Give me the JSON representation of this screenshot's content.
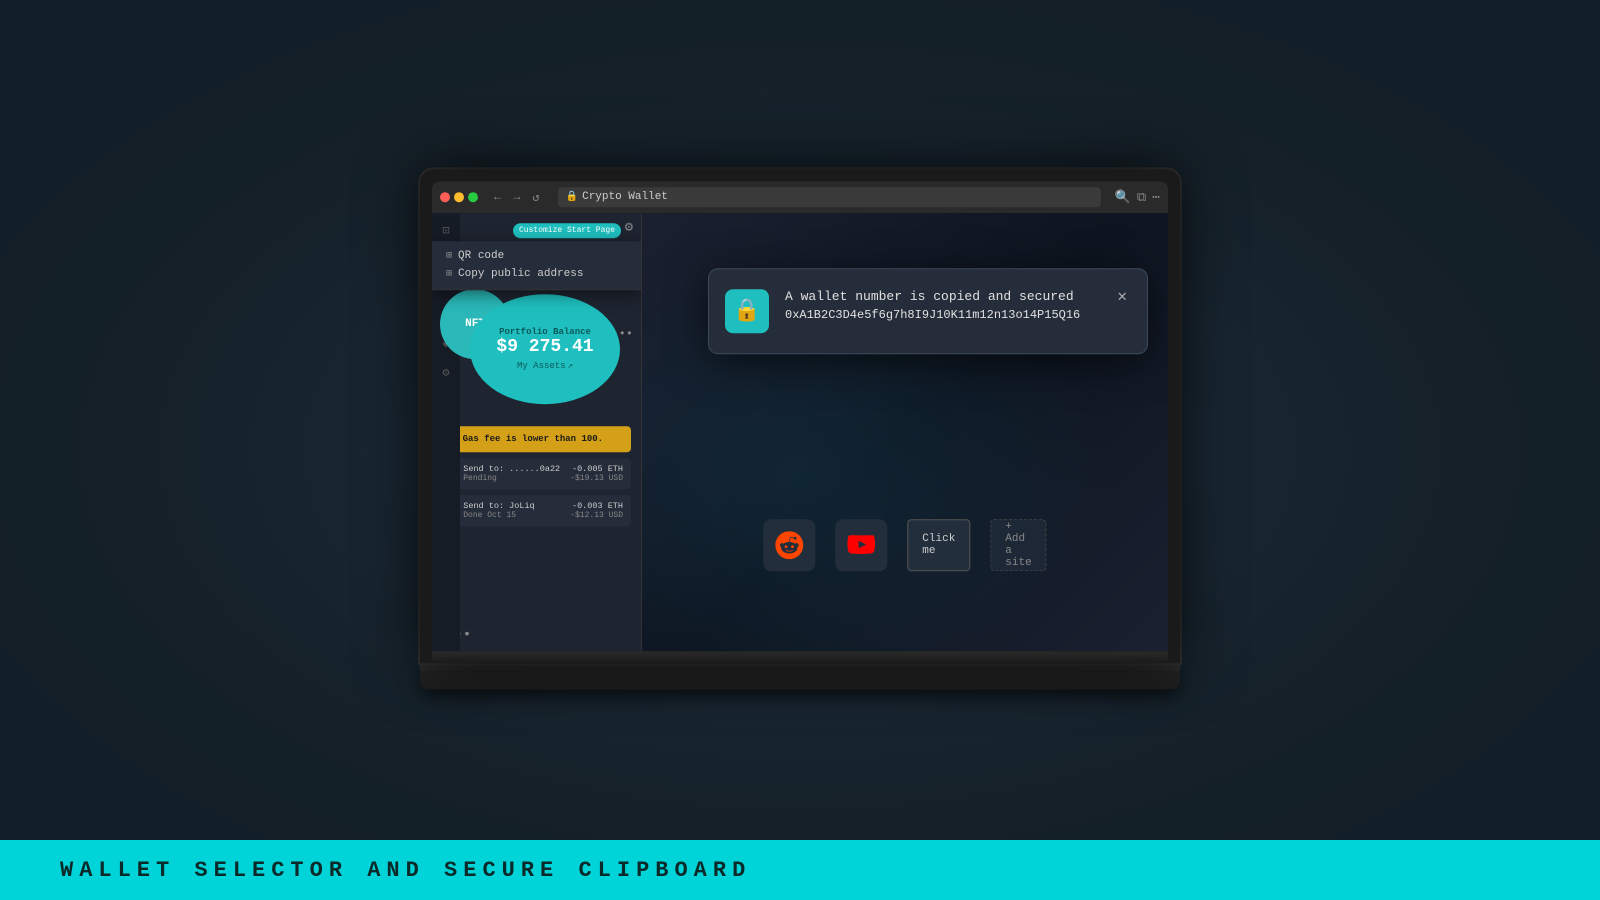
{
  "background": {
    "color": "#1a2a35"
  },
  "bottom_banner": {
    "text": "WALLET SELECTOR AND SECURE CLIPBOARD",
    "bg_color": "#00d4d8"
  },
  "browser": {
    "title": "Crypto Wallet",
    "url": "Crypto Wallet",
    "dots": [
      "red",
      "yellow",
      "green"
    ]
  },
  "wallet": {
    "menu_items": [
      {
        "icon": "⊞",
        "label": "QR code"
      },
      {
        "icon": "⊞",
        "label": "Copy public address"
      }
    ],
    "title": "Crypto Wallet",
    "nft_label": "NFT",
    "portfolio_label": "Portfolio Balance",
    "portfolio_value": "$9 275.41",
    "my_assets_label": "My Assets",
    "customize_btn": "Customize Start Page",
    "gas_warning": "Gas fee is lower than 100.",
    "transactions": [
      {
        "to": "Send to: ......0a22",
        "status": "Pending",
        "eth": "-0.005 ETH",
        "usd": "-$19.13 USD",
        "icon": "↻",
        "pending": true
      },
      {
        "to": "Send to: JoLiq",
        "status": "Done Oct 15",
        "eth": "-0.003 ETH",
        "usd": "-$12.13 USD",
        "icon": "✓",
        "pending": false
      }
    ]
  },
  "shortcuts": [
    {
      "type": "icon",
      "icon": "👾",
      "label": "reddit"
    },
    {
      "type": "icon",
      "icon": "▶",
      "label": "youtube"
    },
    {
      "type": "button",
      "label": "Click me"
    },
    {
      "type": "add",
      "label": "+ Add a site"
    }
  ],
  "notification": {
    "icon": "🔒",
    "title": "A wallet number is copied and secured",
    "address": "0xA1B2C3D4e5f6g7h8I9J10K11m12n13o14P15Q16",
    "close": "✕"
  }
}
